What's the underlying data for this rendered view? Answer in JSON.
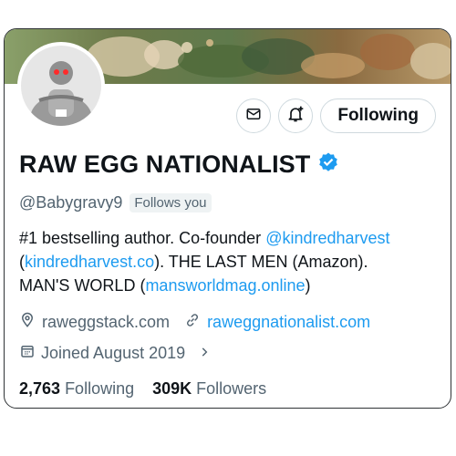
{
  "profile": {
    "display_name": "RAW EGG NATIONALIST",
    "handle": "@Babygravy9",
    "follows_you": "Follows you",
    "verified": true,
    "bio": {
      "line1_text": "#1 bestselling author. Co-founder ",
      "line1_link": "@kindredharvest",
      "line2_paren_open": "(",
      "line2_link": "kindredharvest.co",
      "line2_text": "). THE LAST MEN (Amazon).",
      "line3_text": "MAN'S WORLD (",
      "line3_link": "mansworldmag.online",
      "line3_close": ")"
    },
    "location": "raweggstack.com",
    "website": "raweggnationalist.com",
    "joined": "Joined August 2019",
    "following_count": "2,763",
    "following_label": "Following",
    "followers_count": "309K",
    "followers_label": "Followers"
  },
  "actions": {
    "follow_button": "Following",
    "message_icon": "envelope-icon",
    "notify_icon": "bell-plus-icon"
  },
  "colors": {
    "accent": "#1d9bf0",
    "text": "#0f1419",
    "secondary": "#536471",
    "border": "#cfd9de"
  }
}
